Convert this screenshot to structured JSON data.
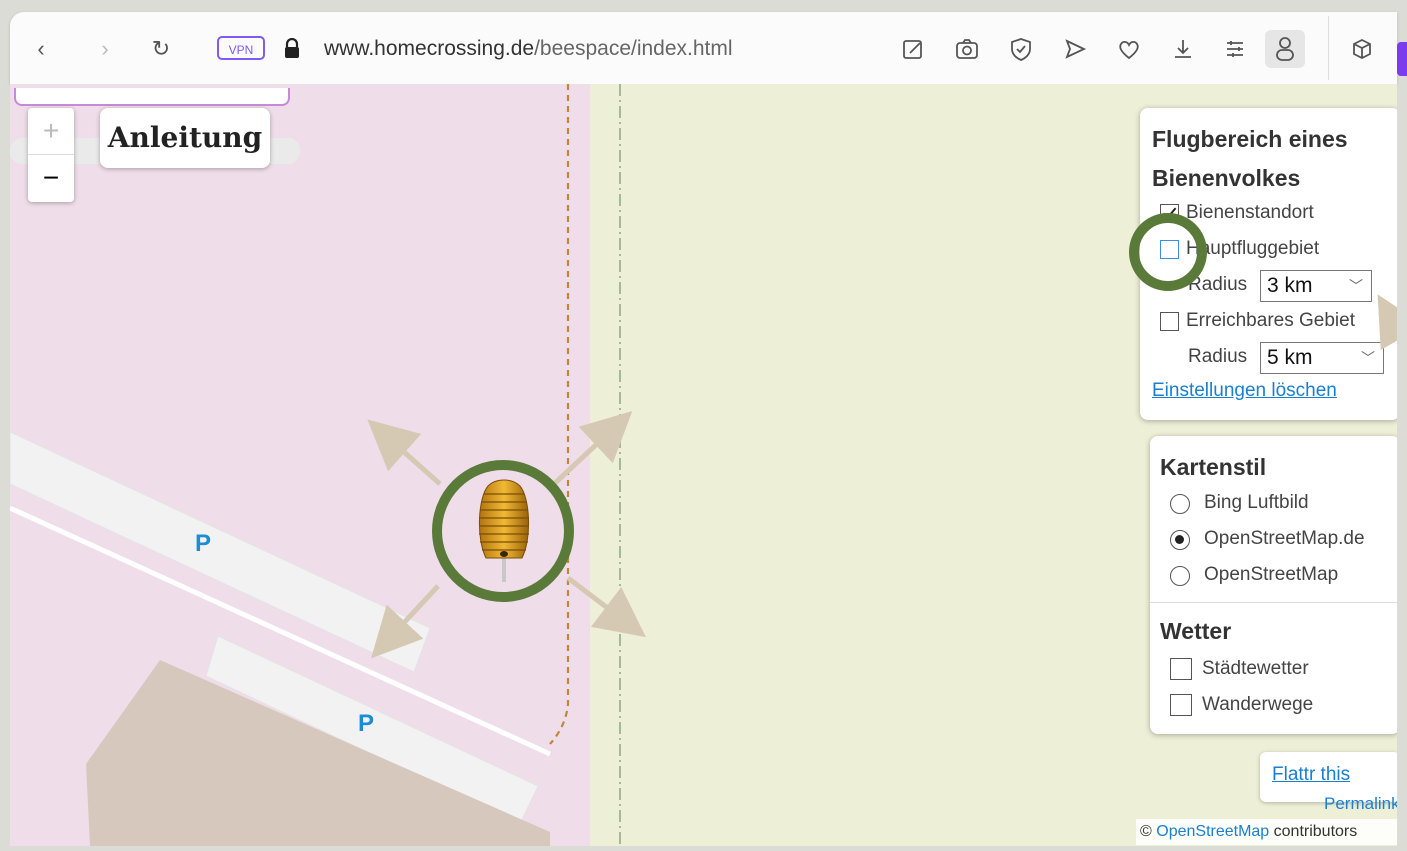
{
  "browser": {
    "url_host": "www.homecrossing.de",
    "url_path": "/beespace/index.html",
    "vpn_label": "VPN",
    "buttons": [
      "back-icon",
      "forward-icon",
      "reload-icon"
    ],
    "toolbar_icons": [
      "edit-icon",
      "camera-icon",
      "shield-icon",
      "send-icon",
      "heart-icon",
      "download-icon",
      "menu-icon",
      "profile-icon",
      "cube-icon"
    ]
  },
  "map": {
    "anleitung_label": "Anleitung",
    "zoom_in": "+",
    "zoom_out": "−",
    "parking_labels": [
      "P",
      "P"
    ]
  },
  "panel_flight": {
    "title": "Flugbereich eines Bienenvolkes",
    "bienenstandort": {
      "label": "Bienenstandort",
      "checked": true
    },
    "hauptfluggebiet": {
      "label": "Hauptfluggebiet",
      "checked": false
    },
    "radius1": {
      "label": "Radius",
      "value": "3 km"
    },
    "erreichbares": {
      "label": "Erreichbares Gebiet",
      "checked": false
    },
    "radius2": {
      "label": "Radius",
      "value": "5 km"
    },
    "clear_link": "Einstellungen löschen"
  },
  "panel_style": {
    "kartenstil_title": "Kartenstil",
    "options": [
      {
        "label": "Bing Luftbild",
        "selected": false
      },
      {
        "label": "OpenStreetMap.de",
        "selected": true
      },
      {
        "label": "OpenStreetMap",
        "selected": false
      }
    ],
    "wetter_title": "Wetter",
    "wetter_options": [
      {
        "label": "Städtewetter",
        "checked": false
      },
      {
        "label": "Wanderwege",
        "checked": false
      }
    ]
  },
  "flattr_label": "Flattr this",
  "permalink_label": "Permalink",
  "attribution": {
    "symbol": "©",
    "link": "OpenStreetMap",
    "suffix": " contributors"
  },
  "colors": {
    "highlight_ring": "#5a7a3a",
    "arrow": "#d6c9b3",
    "map_pink": "#efdde9",
    "map_cream": "#eeefd7",
    "accent_vpn": "#7c5cf4",
    "link": "#1a7fd0"
  }
}
